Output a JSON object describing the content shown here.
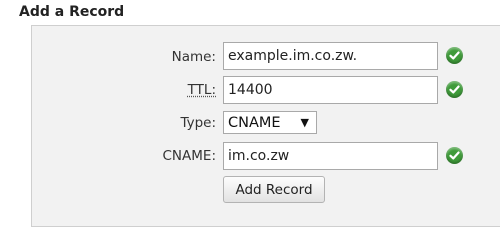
{
  "title": "Add a Record",
  "form": {
    "name_label": "Name:",
    "name_value": "example.im.co.zw.",
    "ttl_label": "TTL:",
    "ttl_value": "14400",
    "type_label": "Type:",
    "type_value": "CNAME",
    "cname_label": "CNAME:",
    "cname_value": "im.co.zw",
    "submit_label": "Add Record"
  },
  "icons": {
    "valid": "check-circle-icon",
    "dropdown": "caret-down-icon"
  },
  "colors": {
    "valid_green": "#3f9b3a",
    "panel_bg": "#f2f2f2"
  }
}
